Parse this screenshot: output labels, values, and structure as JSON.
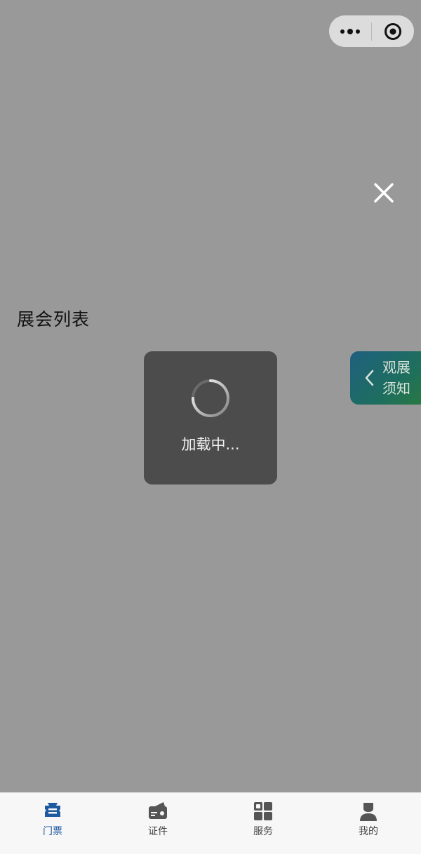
{
  "capsule": {
    "more_icon": "more-dots-icon",
    "close_icon": "target-circle-icon"
  },
  "overlay": {
    "close_icon": "close-icon"
  },
  "page": {
    "title": "展会列表"
  },
  "side_tab": {
    "label": "观展须知",
    "icon": "chevron-left-icon"
  },
  "loading": {
    "text": "加载中..."
  },
  "tabbar": {
    "items": [
      {
        "label": "门票",
        "icon": "ticket-icon",
        "active": true
      },
      {
        "label": "证件",
        "icon": "card-icon",
        "active": false
      },
      {
        "label": "服务",
        "icon": "grid-icon",
        "active": false
      },
      {
        "label": "我的",
        "icon": "user-icon",
        "active": false
      }
    ]
  },
  "colors": {
    "background_dim": "#999999",
    "accent_active": "#1e5aa0",
    "toast_bg": "#4c4c4c",
    "side_tab_gradient_start": "#1f5f7f",
    "side_tab_gradient_end": "#2a7a3c"
  }
}
